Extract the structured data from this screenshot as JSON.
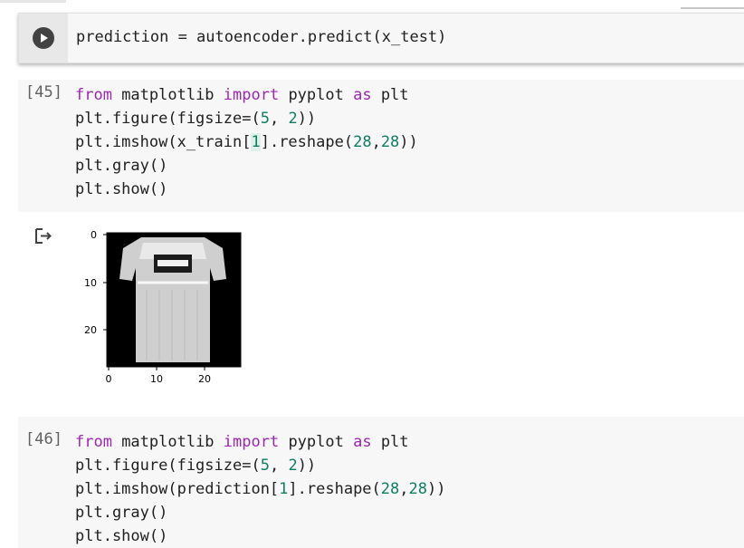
{
  "cells": [
    {
      "id": "cell-predict",
      "exec_count": "",
      "lines": [
        "prediction = autoencoder.predict(x_test)"
      ]
    },
    {
      "id": "cell-45",
      "exec_count": "[45]",
      "lines": [
        "from matplotlib import pyplot as plt",
        "plt.figure(figsize=(5, 2))",
        "plt.imshow(x_train[1].reshape(28,28))",
        "plt.gray()",
        "plt.show()"
      ]
    },
    {
      "id": "cell-46",
      "exec_count": "[46]",
      "lines": [
        "from matplotlib import pyplot as plt",
        "plt.figure(figsize=(5, 2))",
        "plt.imshow(prediction[1].reshape(28,28))",
        "plt.gray()",
        "plt.show()"
      ]
    }
  ],
  "output": {
    "icon": "output-redirect-icon",
    "chart_data": {
      "type": "heatmap",
      "xlim": [
        0,
        27
      ],
      "ylim": [
        27,
        0
      ],
      "x_ticks": [
        "0",
        "10",
        "20"
      ],
      "y_ticks": [
        "0",
        "10",
        "20"
      ],
      "colormap": "gray",
      "content": "T-shirt image 28x28"
    }
  },
  "colors": {
    "keyword": "#9c27b0",
    "number": "#0f7d62",
    "text": "#212121",
    "cell_bg": "#f7f7f7"
  }
}
